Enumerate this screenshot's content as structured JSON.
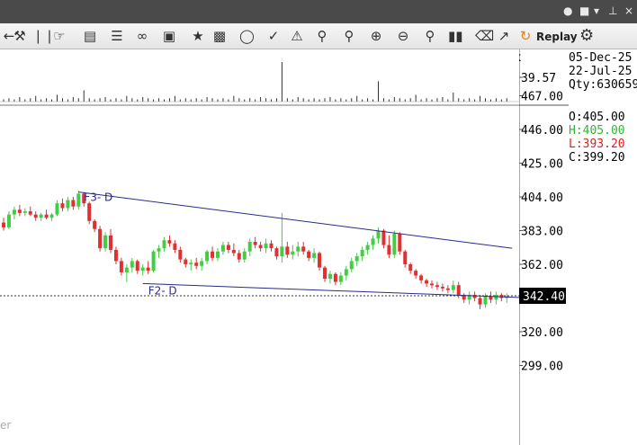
{
  "toolbar": {
    "replay_label": "Replay",
    "icons": [
      "crosshair-icon",
      "wrench-icon",
      "bars-icon",
      "hand-icon",
      "chart-export-icon",
      "properties-icon",
      "link-icon",
      "template-icon",
      "star-icon",
      "chart-type-icon",
      "draw-tool-icon",
      "pin-icon",
      "alert-icon",
      "zoom-icon",
      "zoom-box-icon",
      "zoom-in-icon",
      "zoom-out-icon",
      "zoom-reset-icon",
      "volume-icon",
      "delete-icon",
      "trend-icon",
      "replay-icon",
      "settings-icon"
    ]
  },
  "colors": {
    "up": "#44cc44",
    "down": "#e03030",
    "trendline": "#2a2a8a",
    "price_tag_bg": "#000000"
  },
  "info": {
    "date1": "05-Dec-25",
    "date2": "22-Jul-25",
    "qty": "Qty:630659",
    "open": "O:405.00",
    "high": "H:405.00",
    "low": "L:393.20",
    "close": "C:399.20",
    "volume_tag": "Lk",
    "price_tag": "Lnr"
  },
  "chart_data": {
    "type": "candlestick",
    "volume_axis": {
      "ticks": [
        "39.57"
      ]
    },
    "price_axis": {
      "ticks": [
        "467.00",
        "446.00",
        "425.00",
        "404.00",
        "383.00",
        "362.00",
        "320.00",
        "299.00"
      ],
      "ylim": [
        291,
        473
      ]
    },
    "last_price": "342.40",
    "trendlines": [
      {
        "label": "F3- D",
        "from": [
          14,
          407
        ],
        "to": [
          95,
          372
        ]
      },
      {
        "label": "F2- D",
        "from": [
          26,
          350
        ],
        "to": [
          99,
          341
        ]
      }
    ],
    "candles": [
      [
        0,
        388,
        391,
        383,
        385
      ],
      [
        1,
        385,
        395,
        384,
        393
      ],
      [
        2,
        393,
        398,
        390,
        396
      ],
      [
        3,
        396,
        399,
        392,
        394
      ],
      [
        4,
        394,
        397,
        392,
        395
      ],
      [
        5,
        395,
        398,
        392,
        393
      ],
      [
        6,
        393,
        395,
        389,
        391
      ],
      [
        7,
        391,
        394,
        389,
        393
      ],
      [
        8,
        393,
        396,
        390,
        391
      ],
      [
        9,
        391,
        394,
        389,
        393
      ],
      [
        10,
        393,
        402,
        392,
        400
      ],
      [
        11,
        400,
        403,
        395,
        397
      ],
      [
        12,
        397,
        404,
        395,
        402
      ],
      [
        13,
        402,
        404,
        396,
        398
      ],
      [
        14,
        398,
        408,
        396,
        406
      ],
      [
        15,
        406,
        407,
        398,
        400
      ],
      [
        16,
        400,
        401,
        387,
        389
      ],
      [
        17,
        389,
        390,
        382,
        384
      ],
      [
        18,
        384,
        386,
        370,
        372
      ],
      [
        19,
        372,
        382,
        370,
        380
      ],
      [
        20,
        380,
        384,
        369,
        371
      ],
      [
        21,
        371,
        373,
        362,
        364
      ],
      [
        22,
        364,
        366,
        355,
        357
      ],
      [
        23,
        357,
        362,
        351,
        360
      ],
      [
        24,
        360,
        366,
        357,
        364
      ],
      [
        25,
        364,
        365,
        356,
        358
      ],
      [
        26,
        358,
        362,
        355,
        360
      ],
      [
        27,
        360,
        364,
        356,
        358
      ],
      [
        28,
        358,
        371,
        357,
        370
      ],
      [
        29,
        370,
        374,
        366,
        372
      ],
      [
        30,
        372,
        379,
        370,
        377
      ],
      [
        31,
        377,
        380,
        373,
        375
      ],
      [
        32,
        375,
        377,
        369,
        371
      ],
      [
        33,
        371,
        373,
        363,
        365
      ],
      [
        34,
        365,
        366,
        360,
        362
      ],
      [
        35,
        362,
        365,
        358,
        363
      ],
      [
        36,
        363,
        366,
        359,
        361
      ],
      [
        37,
        361,
        366,
        358,
        364
      ],
      [
        38,
        364,
        371,
        362,
        370
      ],
      [
        39,
        370,
        373,
        364,
        366
      ],
      [
        40,
        366,
        372,
        364,
        370
      ],
      [
        41,
        370,
        376,
        368,
        374
      ],
      [
        42,
        374,
        376,
        369,
        371
      ],
      [
        43,
        371,
        375,
        367,
        369
      ],
      [
        44,
        369,
        371,
        363,
        365
      ],
      [
        45,
        365,
        372,
        363,
        370
      ],
      [
        46,
        370,
        378,
        367,
        376
      ],
      [
        47,
        376,
        379,
        372,
        374
      ],
      [
        48,
        374,
        376,
        370,
        372
      ],
      [
        49,
        372,
        378,
        369,
        375
      ],
      [
        50,
        375,
        377,
        370,
        372
      ],
      [
        51,
        372,
        373,
        365,
        367
      ],
      [
        52,
        367,
        394,
        363,
        373
      ],
      [
        53,
        373,
        376,
        366,
        368
      ],
      [
        54,
        368,
        374,
        365,
        370
      ],
      [
        55,
        370,
        376,
        367,
        373
      ],
      [
        56,
        373,
        376,
        368,
        370
      ],
      [
        57,
        370,
        371,
        364,
        366
      ],
      [
        58,
        366,
        372,
        363,
        369
      ],
      [
        59,
        369,
        370,
        358,
        360
      ],
      [
        60,
        360,
        361,
        351,
        353
      ],
      [
        61,
        353,
        358,
        350,
        356
      ],
      [
        62,
        356,
        357,
        349,
        351
      ],
      [
        63,
        351,
        357,
        349,
        355
      ],
      [
        64,
        355,
        361,
        352,
        359
      ],
      [
        65,
        359,
        366,
        357,
        364
      ],
      [
        66,
        364,
        369,
        361,
        367
      ],
      [
        67,
        367,
        373,
        364,
        371
      ],
      [
        68,
        371,
        376,
        368,
        374
      ],
      [
        69,
        374,
        380,
        371,
        378
      ],
      [
        70,
        378,
        385,
        375,
        383
      ],
      [
        71,
        383,
        384,
        372,
        374
      ],
      [
        72,
        374,
        380,
        366,
        368
      ],
      [
        73,
        368,
        383,
        366,
        381
      ],
      [
        74,
        381,
        382,
        368,
        370
      ],
      [
        75,
        370,
        371,
        360,
        362
      ],
      [
        76,
        362,
        363,
        356,
        358
      ],
      [
        77,
        358,
        359,
        353,
        355
      ],
      [
        78,
        355,
        356,
        350,
        352
      ],
      [
        79,
        352,
        353,
        348,
        350
      ],
      [
        80,
        350,
        352,
        347,
        349
      ],
      [
        81,
        349,
        351,
        346,
        348
      ],
      [
        82,
        348,
        350,
        345,
        347
      ],
      [
        83,
        347,
        349,
        344,
        346
      ],
      [
        84,
        346,
        352,
        344,
        349
      ],
      [
        85,
        349,
        351,
        341,
        343
      ],
      [
        86,
        343,
        344,
        338,
        340
      ],
      [
        87,
        340,
        345,
        337,
        343
      ],
      [
        88,
        343,
        345,
        339,
        341
      ],
      [
        89,
        341,
        343,
        334,
        337
      ],
      [
        90,
        337,
        344,
        335,
        342
      ],
      [
        91,
        342,
        345,
        338,
        340
      ],
      [
        92,
        340,
        345,
        337,
        343
      ],
      [
        93,
        343,
        344,
        339,
        341
      ],
      [
        94,
        341,
        344,
        338,
        342
      ]
    ],
    "volumes": [
      2,
      3,
      2,
      4,
      2,
      3,
      5,
      2,
      3,
      2,
      6,
      3,
      2,
      4,
      3,
      10,
      3,
      2,
      3,
      4,
      2,
      3,
      2,
      5,
      3,
      2,
      4,
      3,
      2,
      3,
      2,
      3,
      5,
      2,
      3,
      2,
      3,
      2,
      4,
      3,
      2,
      3,
      2,
      5,
      3,
      2,
      3,
      2,
      4,
      3,
      2,
      3,
      35,
      3,
      2,
      4,
      3,
      2,
      3,
      2,
      3,
      4,
      2,
      3,
      2,
      3,
      5,
      2,
      3,
      2,
      18,
      3,
      2,
      4,
      3,
      2,
      3,
      6,
      2,
      3,
      2,
      3,
      4,
      2,
      8,
      3,
      2,
      3,
      2,
      5,
      3,
      2,
      3,
      2,
      3
    ]
  }
}
